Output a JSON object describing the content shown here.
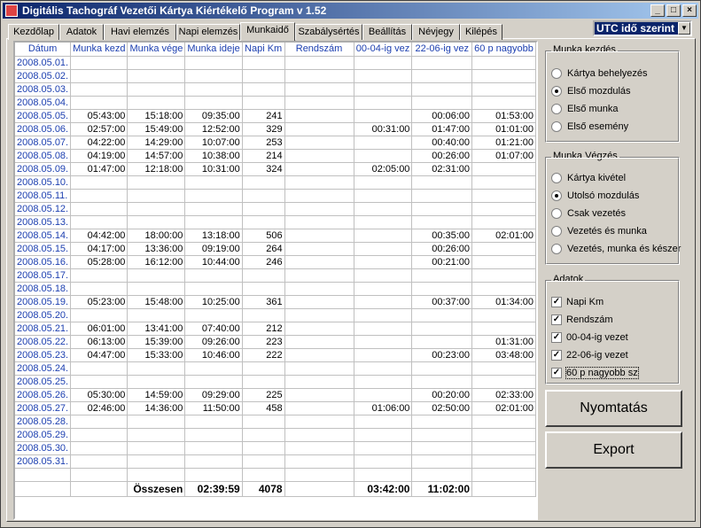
{
  "window": {
    "title": "Digitális Tachográf Vezetői Kártya Kiértékelő Program    v 1.52"
  },
  "utc": {
    "selected": "UTC idő szerint"
  },
  "tabs": [
    "Kezdőlap",
    "Adatok",
    "Havi elemzés",
    "Napi elemzés",
    "Munkaidő",
    "Szabálysértés",
    "Beállítás",
    "Névjegy",
    "Kilépés"
  ],
  "table": {
    "columns": [
      "Dátum",
      "Munka kezd",
      "Munka vége",
      "Munka ideje",
      "Napi Km",
      "Rendszám",
      "00-04-ig vez",
      "22-06-ig vez",
      "60 p nagyobb"
    ],
    "rows": [
      [
        "2008.05.01.",
        "",
        "",
        "",
        "",
        "",
        "",
        "",
        ""
      ],
      [
        "2008.05.02.",
        "",
        "",
        "",
        "",
        "",
        "",
        "",
        ""
      ],
      [
        "2008.05.03.",
        "",
        "",
        "",
        "",
        "",
        "",
        "",
        ""
      ],
      [
        "2008.05.04.",
        "",
        "",
        "",
        "",
        "",
        "",
        "",
        ""
      ],
      [
        "2008.05.05.",
        "05:43:00",
        "15:18:00",
        "09:35:00",
        "241",
        "",
        "",
        "00:06:00",
        "01:53:00"
      ],
      [
        "2008.05.06.",
        "02:57:00",
        "15:49:00",
        "12:52:00",
        "329",
        "",
        "00:31:00",
        "01:47:00",
        "01:01:00"
      ],
      [
        "2008.05.07.",
        "04:22:00",
        "14:29:00",
        "10:07:00",
        "253",
        "",
        "",
        "00:40:00",
        "01:21:00"
      ],
      [
        "2008.05.08.",
        "04:19:00",
        "14:57:00",
        "10:38:00",
        "214",
        "",
        "",
        "00:26:00",
        "01:07:00"
      ],
      [
        "2008.05.09.",
        "01:47:00",
        "12:18:00",
        "10:31:00",
        "324",
        "",
        "02:05:00",
        "02:31:00",
        ""
      ],
      [
        "2008.05.10.",
        "",
        "",
        "",
        "",
        "",
        "",
        "",
        ""
      ],
      [
        "2008.05.11.",
        "",
        "",
        "",
        "",
        "",
        "",
        "",
        ""
      ],
      [
        "2008.05.12.",
        "",
        "",
        "",
        "",
        "",
        "",
        "",
        ""
      ],
      [
        "2008.05.13.",
        "",
        "",
        "",
        "",
        "",
        "",
        "",
        ""
      ],
      [
        "2008.05.14.",
        "04:42:00",
        "18:00:00",
        "13:18:00",
        "506",
        "",
        "",
        "00:35:00",
        "02:01:00"
      ],
      [
        "2008.05.15.",
        "04:17:00",
        "13:36:00",
        "09:19:00",
        "264",
        "",
        "",
        "00:26:00",
        ""
      ],
      [
        "2008.05.16.",
        "05:28:00",
        "16:12:00",
        "10:44:00",
        "246",
        "",
        "",
        "00:21:00",
        ""
      ],
      [
        "2008.05.17.",
        "",
        "",
        "",
        "",
        "",
        "",
        "",
        ""
      ],
      [
        "2008.05.18.",
        "",
        "",
        "",
        "",
        "",
        "",
        "",
        ""
      ],
      [
        "2008.05.19.",
        "05:23:00",
        "15:48:00",
        "10:25:00",
        "361",
        "",
        "",
        "00:37:00",
        "01:34:00"
      ],
      [
        "2008.05.20.",
        "",
        "",
        "",
        "",
        "",
        "",
        "",
        ""
      ],
      [
        "2008.05.21.",
        "06:01:00",
        "13:41:00",
        "07:40:00",
        "212",
        "",
        "",
        "",
        ""
      ],
      [
        "2008.05.22.",
        "06:13:00",
        "15:39:00",
        "09:26:00",
        "223",
        "",
        "",
        "",
        "01:31:00"
      ],
      [
        "2008.05.23.",
        "04:47:00",
        "15:33:00",
        "10:46:00",
        "222",
        "",
        "",
        "00:23:00",
        "03:48:00"
      ],
      [
        "2008.05.24.",
        "",
        "",
        "",
        "",
        "",
        "",
        "",
        ""
      ],
      [
        "2008.05.25.",
        "",
        "",
        "",
        "",
        "",
        "",
        "",
        ""
      ],
      [
        "2008.05.26.",
        "05:30:00",
        "14:59:00",
        "09:29:00",
        "225",
        "",
        "",
        "00:20:00",
        "02:33:00"
      ],
      [
        "2008.05.27.",
        "02:46:00",
        "14:36:00",
        "11:50:00",
        "458",
        "",
        "01:06:00",
        "02:50:00",
        "02:01:00"
      ],
      [
        "2008.05.28.",
        "",
        "",
        "",
        "",
        "",
        "",
        "",
        ""
      ],
      [
        "2008.05.29.",
        "",
        "",
        "",
        "",
        "",
        "",
        "",
        ""
      ],
      [
        "2008.05.30.",
        "",
        "",
        "",
        "",
        "",
        "",
        "",
        ""
      ],
      [
        "2008.05.31.",
        "",
        "",
        "",
        "",
        "",
        "",
        "",
        ""
      ],
      [
        "",
        "",
        "",
        "",
        "",
        "",
        "",
        "",
        ""
      ]
    ],
    "total": [
      "",
      "",
      "Összesen",
      "02:39:59",
      "4078",
      "",
      "03:42:00",
      "11:02:00",
      ""
    ]
  },
  "work_start": {
    "legend": "Munka kezdés",
    "options": [
      {
        "label": "Kártya behelyezés",
        "selected": false
      },
      {
        "label": "Első mozdulás",
        "selected": true
      },
      {
        "label": "Első munka",
        "selected": false
      },
      {
        "label": "Első esemény",
        "selected": false
      }
    ]
  },
  "work_end": {
    "legend": "Munka Végzés",
    "options": [
      {
        "label": "Kártya kivétel",
        "selected": false
      },
      {
        "label": "Utolsó mozdulás",
        "selected": true
      },
      {
        "label": "Csak vezetés",
        "selected": false
      },
      {
        "label": "Vezetés és munka",
        "selected": false
      },
      {
        "label": "Vezetés, munka és készer",
        "selected": false
      }
    ]
  },
  "data_opts": {
    "legend": "Adatok",
    "options": [
      {
        "label": "Napi Km",
        "checked": true
      },
      {
        "label": "Rendszám",
        "checked": true
      },
      {
        "label": "00-04-ig vezet",
        "checked": true
      },
      {
        "label": "22-06-ig vezet",
        "checked": true
      },
      {
        "label": "60 p nagyobb sz",
        "checked": true
      }
    ]
  },
  "buttons": {
    "print": "Nyomtatás",
    "export": "Export"
  }
}
